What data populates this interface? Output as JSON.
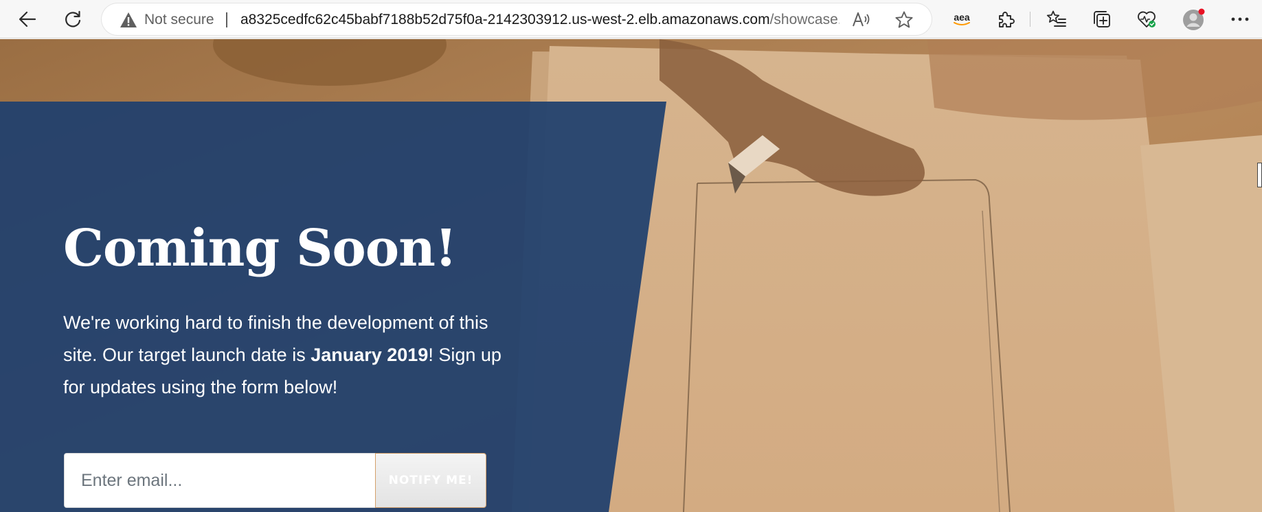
{
  "browser": {
    "security_label": "Not secure",
    "url_main": "a8325cedfc62c45babf7188b52d75f0a-2142303912.us-west-2.elb.amazonaws.com",
    "url_rest": "/showcase....",
    "extension_label": "aea",
    "icons": {
      "back": "back-arrow-icon",
      "reload": "reload-icon",
      "warning": "warning-icon",
      "read_aloud": "read-aloud-icon",
      "favorite": "star-icon",
      "extensions": "puzzle-icon",
      "favorites": "favorites-list-icon",
      "collections": "collections-icon",
      "health": "browser-essentials-icon",
      "profile": "profile-avatar-icon",
      "menu": "more-menu-icon"
    },
    "colors": {
      "profile_notification": "#e81123",
      "health_badge": "#16a34a",
      "extension_accent": "#ff9900"
    }
  },
  "hero": {
    "title": "Coming Soon!",
    "text_part1": "We're working hard to finish the development of this site. Our target launch date is ",
    "launch_date": "January 2019",
    "text_part2": "! Sign up for updates using the form below!",
    "panel_color": "#1f3f6e"
  },
  "signup": {
    "email_placeholder": "Enter email...",
    "email_value": "",
    "button_label": "NOTIFY ME!"
  }
}
